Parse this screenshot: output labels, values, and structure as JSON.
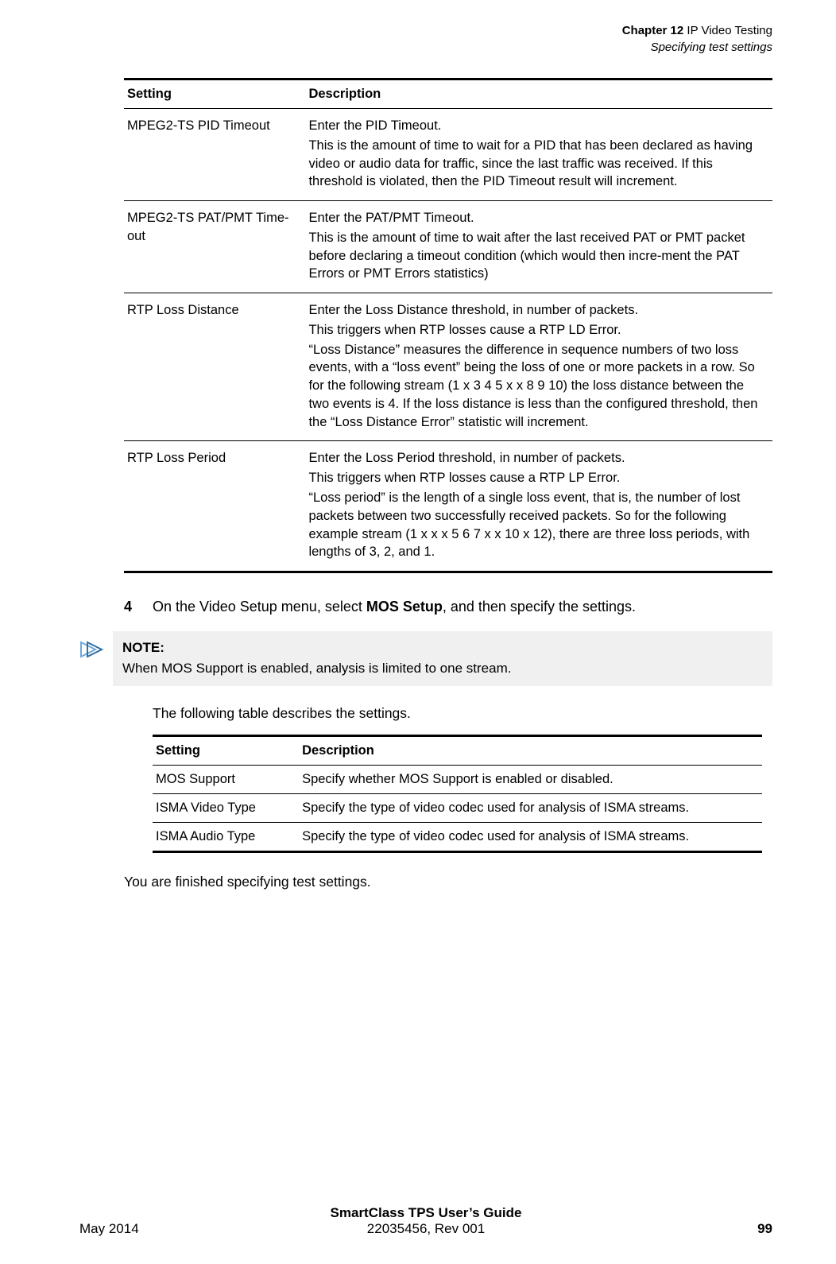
{
  "header": {
    "chapter_prefix": "Chapter 12",
    "chapter_title": "IP Video Testing",
    "section": "Specifying test settings"
  },
  "table1": {
    "headers": {
      "setting": "Setting",
      "description": "Description"
    },
    "rows": [
      {
        "setting": "MPEG2-TS PID Timeout",
        "p1": "Enter the PID Timeout.",
        "p2": "This is the amount of time to wait for a PID that has been declared as having video or audio data for traffic, since the last traffic was received. If this threshold is violated, then the PID Timeout result will increment."
      },
      {
        "setting": "MPEG2-TS PAT/PMT Time-out",
        "p1": "Enter the PAT/PMT Timeout.",
        "p2": "This is the amount of time to wait after the last received PAT or PMT packet before declaring a timeout condition (which would then incre-ment the PAT Errors or PMT Errors statistics)"
      },
      {
        "setting": "RTP Loss Distance",
        "p1": "Enter the Loss Distance threshold, in number of packets.",
        "p2": "This triggers when RTP losses cause a RTP LD Error.",
        "p3": "“Loss Distance” measures the difference in sequence numbers of two loss events, with a “loss event” being the loss of one or more packets in a row. So for the following stream (1 x 3 4 5 x x 8 9 10) the loss distance between the two events is 4. If the loss distance is less than the configured threshold, then the “Loss Distance Error” statistic will increment."
      },
      {
        "setting": "RTP Loss Period",
        "p1": "Enter the Loss Period threshold, in number of packets.",
        "p2": "This triggers when RTP losses cause a RTP LP Error.",
        "p3": "“Loss period” is the length of a single loss event, that is, the number of lost packets between two successfully received packets. So for the following example stream (1 x x x 5 6 7 x x 10 x 12), there are three loss periods, with lengths of 3, 2, and 1."
      }
    ]
  },
  "step4": {
    "num": "4",
    "text_before": "On the Video Setup menu, select ",
    "bold": "MOS Setup",
    "text_after": ", and then specify the settings."
  },
  "note": {
    "label": "NOTE:",
    "text": "When MOS Support is enabled, analysis is limited to one stream."
  },
  "para_after_note": "The following table describes the settings.",
  "table2": {
    "headers": {
      "setting": "Setting",
      "description": "Description"
    },
    "rows": [
      {
        "setting": "MOS Support",
        "desc": "Specify whether MOS Support is enabled or disabled."
      },
      {
        "setting": "ISMA Video Type",
        "desc": "Specify the type of video codec used for analysis of ISMA streams."
      },
      {
        "setting": "ISMA Audio Type",
        "desc": "Specify the type of video codec used for analysis of ISMA streams."
      }
    ]
  },
  "closing": "You are finished specifying test settings.",
  "footer": {
    "date": "May 2014",
    "guide": "SmartClass TPS User’s Guide",
    "docnum": "22035456, Rev 001",
    "page": "99"
  }
}
